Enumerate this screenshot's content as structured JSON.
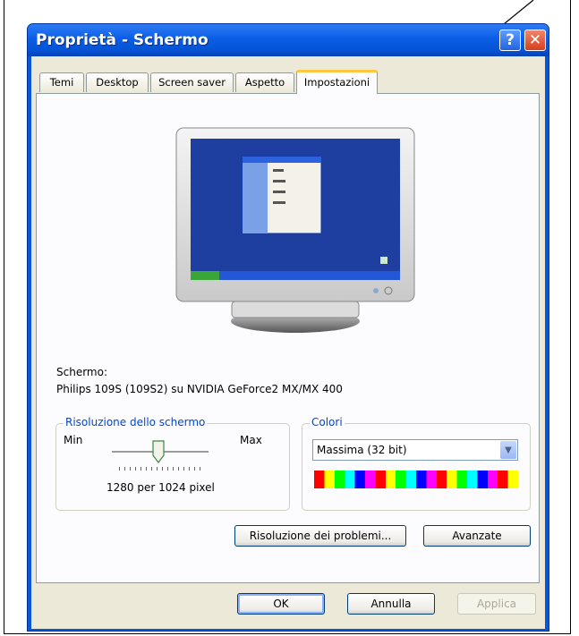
{
  "window": {
    "title": "Proprietà - Schermo",
    "help_glyph": "?",
    "close_glyph": "✕"
  },
  "tabs": [
    {
      "label": "Temi"
    },
    {
      "label": "Desktop"
    },
    {
      "label": "Screen saver"
    },
    {
      "label": "Aspetto"
    },
    {
      "label": "Impostazioni",
      "active": true
    }
  ],
  "display": {
    "label": "Schermo:",
    "device": "Philips 109S (109S2) su NVIDIA GeForce2 MX/MX 400"
  },
  "resolution": {
    "legend": "Risoluzione dello schermo",
    "min_label": "Min",
    "max_label": "Max",
    "value_text": "1280 per 1024 pixel"
  },
  "colors": {
    "legend": "Colori",
    "selected": "Massima (32 bit)"
  },
  "buttons": {
    "troubleshoot": "Risoluzione dei problemi...",
    "advanced": "Avanzate",
    "ok": "OK",
    "cancel": "Annulla",
    "apply": "Applica"
  },
  "theme_colors": {
    "titlebar": "#0553d6",
    "face": "#ece9d8",
    "legend_text": "#0046d5",
    "active_tab_accent": "#ffc83c"
  }
}
